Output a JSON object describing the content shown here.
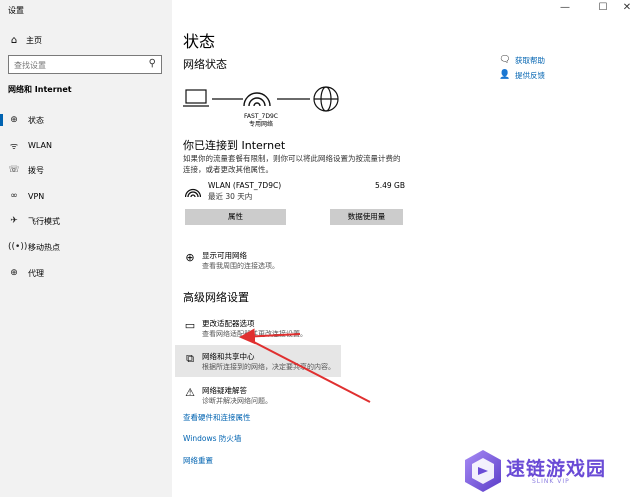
{
  "window": {
    "title": "设置",
    "controls": {
      "minimize": "—",
      "maximize": "☐",
      "close": "✕"
    }
  },
  "sidebar": {
    "home_label": "主页",
    "search_placeholder": "查找设置",
    "section_label": "网络和 Internet",
    "items": [
      {
        "label": "状态",
        "icon": "globe-icon",
        "active": true
      },
      {
        "label": "WLAN",
        "icon": "wifi-icon"
      },
      {
        "label": "拨号",
        "icon": "dialup-icon"
      },
      {
        "label": "VPN",
        "icon": "vpn-icon"
      },
      {
        "label": "飞行模式",
        "icon": "airplane-icon"
      },
      {
        "label": "移动热点",
        "icon": "hotspot-icon"
      },
      {
        "label": "代理",
        "icon": "proxy-globe-icon"
      }
    ]
  },
  "main": {
    "title": "状态",
    "network_status_heading": "网络状态",
    "router_name": "FAST_7D9C",
    "router_type": "专用网络",
    "connected_title": "你已连接到 Internet",
    "connected_desc": "如果你的流量套餐有限制，则你可以将此网络设置为按流量计费的连接，或者更改其他属性。",
    "wifi": {
      "name": "WLAN (FAST_7D9C)",
      "days": "最近 30 天内",
      "usage": "5.49 GB"
    },
    "buttons": {
      "properties": "属性",
      "data_usage": "数据使用量"
    },
    "show_networks": {
      "title": "显示可用网络",
      "subtitle": "查看我周围的连接选项。"
    },
    "advanced_heading": "高级网络设置",
    "adapter_options": {
      "title": "更改适配器选项",
      "subtitle": "查看网络适配器并更改连接设置。"
    },
    "sharing_center": {
      "title": "网络和共享中心",
      "subtitle": "根据所连接到的网络，决定要共享的内容。"
    },
    "troubleshooter": {
      "title": "网络疑难解答",
      "subtitle": "诊断并解决网络问题。"
    },
    "links": {
      "hardware": "查看硬件和连接属性",
      "firewall": "Windows 防火墙",
      "reset": "网络重置"
    },
    "help": {
      "get_help": "获取帮助",
      "feedback": "提供反馈"
    }
  },
  "watermark": {
    "name": "速链游戏园",
    "sub": "SLINK VIP"
  },
  "colors": {
    "accent": "#0063b1",
    "sidebar_bg": "#f2f2f2",
    "arrow": "#e03030"
  }
}
